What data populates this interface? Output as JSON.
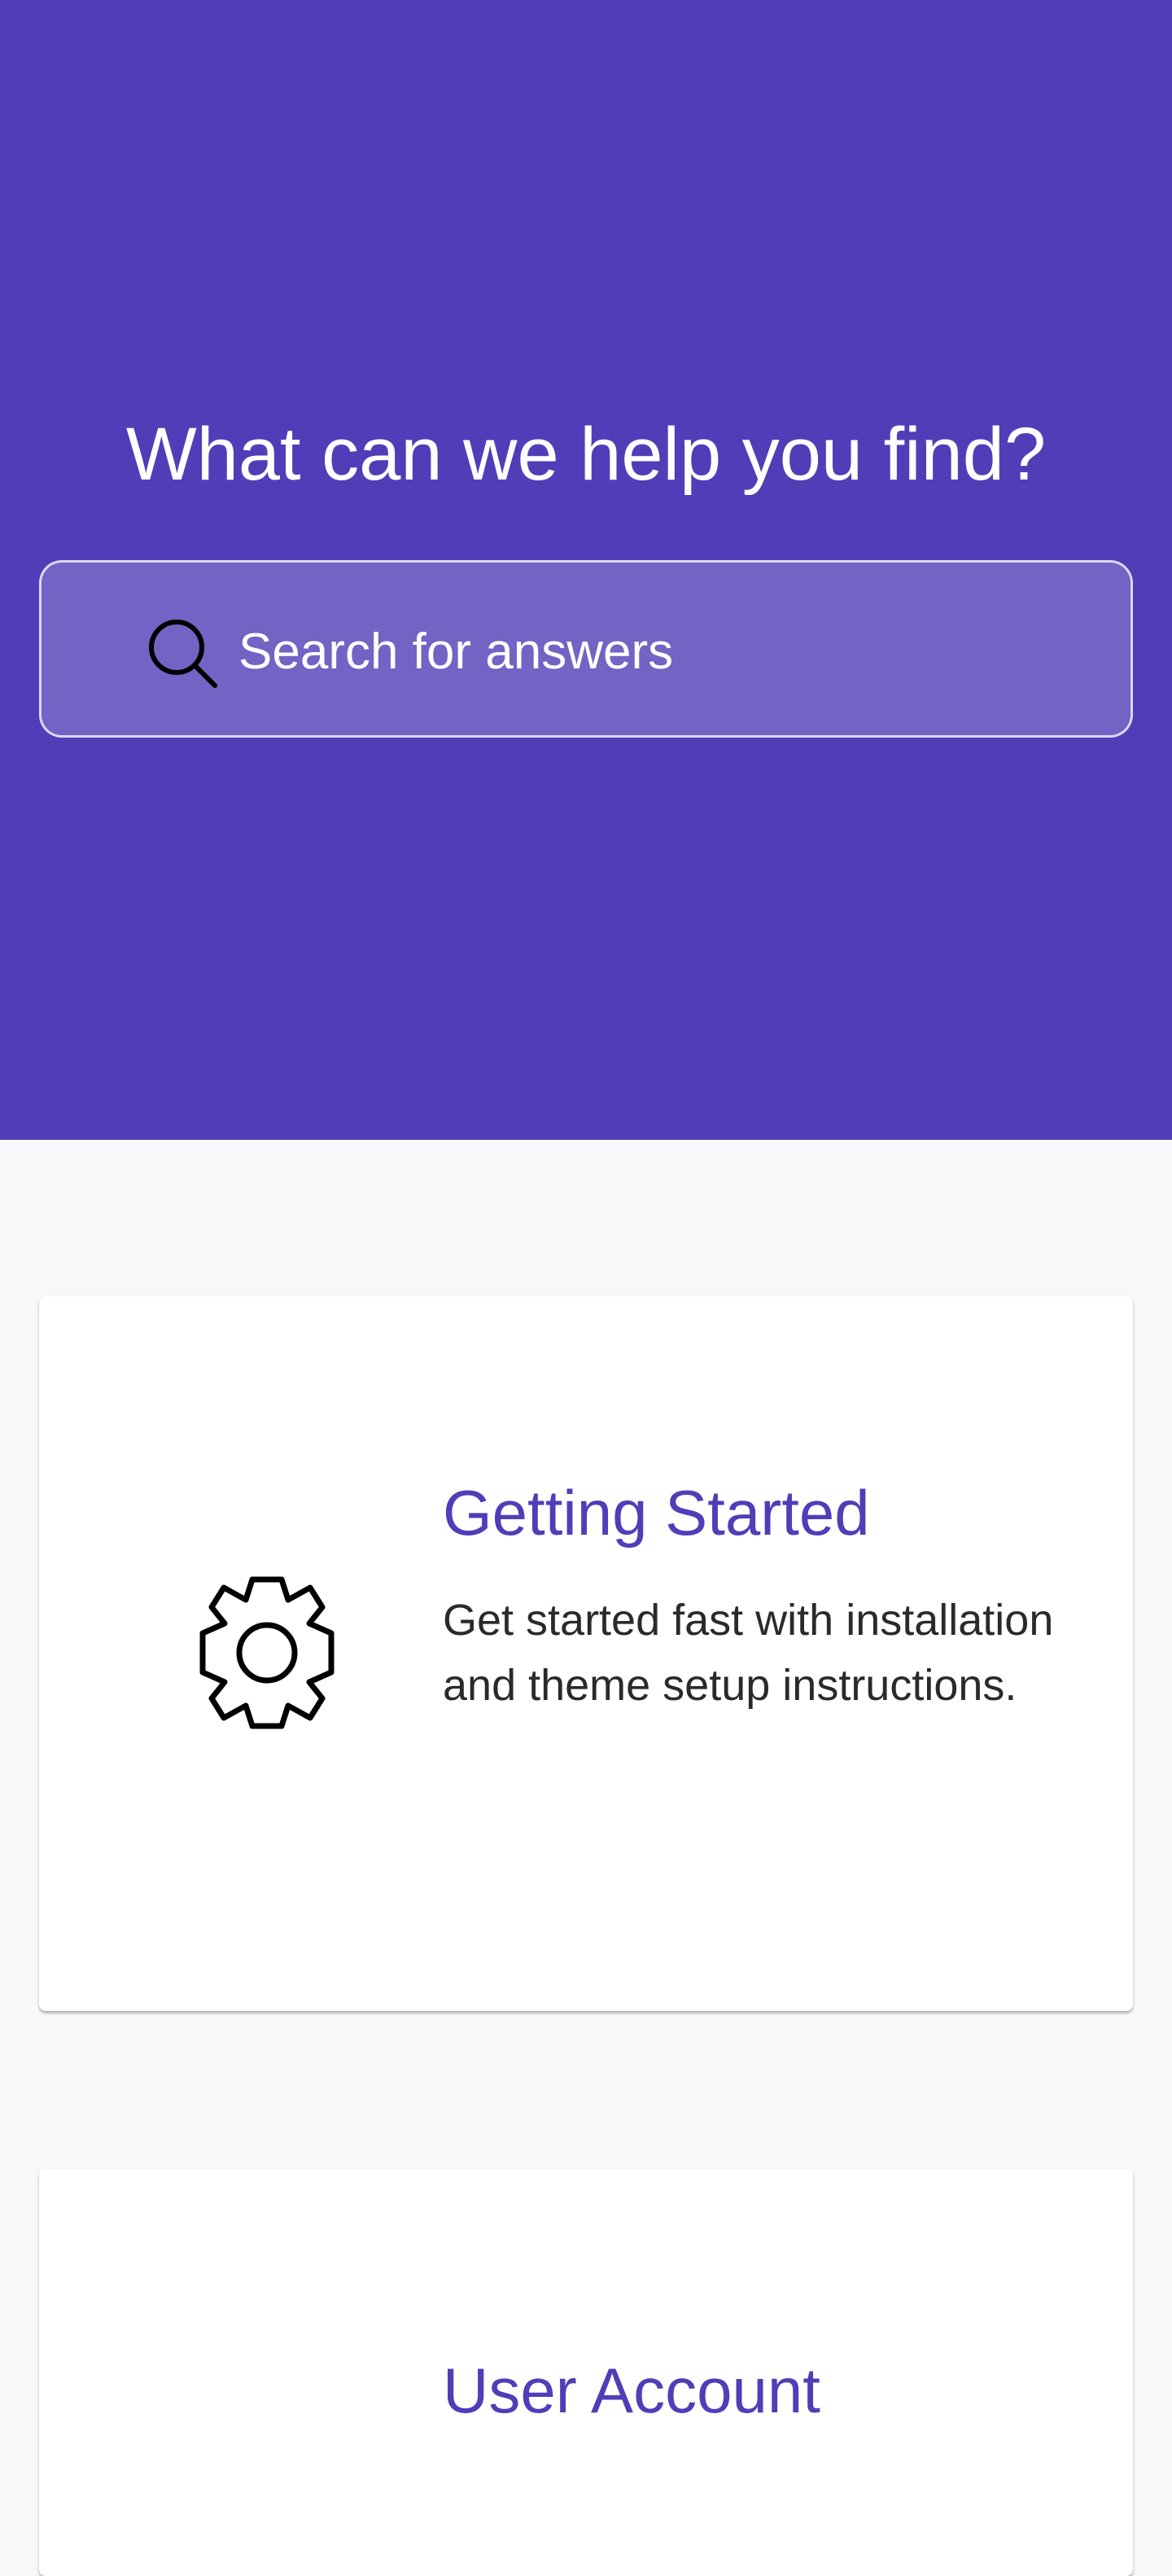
{
  "hero": {
    "title": "What can we help you find?",
    "background": "#513db8"
  },
  "search": {
    "placeholder": "Search for answers",
    "value": "",
    "icon": "search-icon"
  },
  "cards": [
    {
      "icon": "gear-icon",
      "title": "Getting Started",
      "description": "Get started fast with installation and theme setup instructions."
    },
    {
      "title": "User Account"
    }
  ],
  "colors": {
    "accent": "#513db8",
    "page_background": "#f8f8fa",
    "card_background": "#ffffff"
  }
}
